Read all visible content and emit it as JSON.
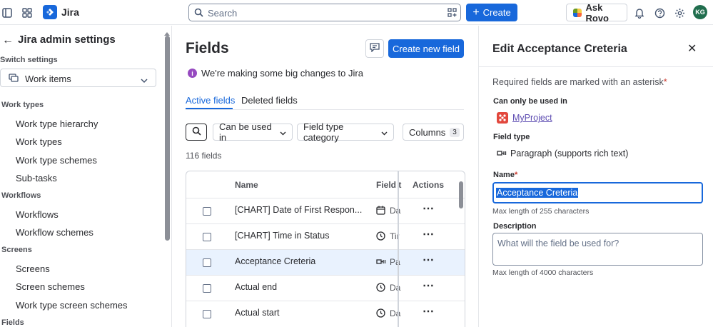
{
  "topbar": {
    "app_name": "Jira",
    "search_placeholder": "Search",
    "create_label": "Create",
    "rovo_label": "Ask Rovo",
    "avatar_initials": "KG",
    "accent_color": "#1868db"
  },
  "sidebar": {
    "title": "Jira admin settings",
    "switch_label": "Switch settings",
    "switch_value": "Work items",
    "sections": [
      {
        "label": "Work types",
        "items": [
          "Work type hierarchy",
          "Work types",
          "Work type schemes",
          "Sub-tasks"
        ]
      },
      {
        "label": "Workflows",
        "items": [
          "Workflows",
          "Workflow schemes"
        ]
      },
      {
        "label": "Screens",
        "items": [
          "Screens",
          "Screen schemes",
          "Work type screen schemes"
        ]
      },
      {
        "label": "Fields",
        "items": []
      }
    ]
  },
  "main": {
    "title": "Fields",
    "create_button": "Create new field",
    "notice": "We're making some big changes to Jira",
    "tabs": [
      {
        "label": "Active fields",
        "active": true
      },
      {
        "label": "Deleted fields",
        "active": false
      }
    ],
    "filters": {
      "can_be_used_in": "Can be used in",
      "field_type_category": "Field type category",
      "columns": "Columns",
      "columns_count": "3"
    },
    "fields_count": "116 fields",
    "table": {
      "headers": {
        "name": "Name",
        "field_type": "Field t",
        "actions": "Actions"
      },
      "rows": [
        {
          "name": "[CHART] Date of First Respon...",
          "type": "Da",
          "icon": "calendar-icon",
          "selected": false
        },
        {
          "name": "[CHART] Time in Status",
          "type": "Tir",
          "icon": "clock-icon",
          "selected": false
        },
        {
          "name": "Acceptance Creteria",
          "type": "Pa",
          "icon": "paragraph-icon",
          "selected": true
        },
        {
          "name": "Actual end",
          "type": "Da",
          "icon": "clock-icon",
          "selected": false
        },
        {
          "name": "Actual start",
          "type": "Da",
          "icon": "clock-icon",
          "selected": false
        }
      ],
      "actions_glyph": "⋯"
    }
  },
  "panel": {
    "title": "Edit Acceptance Creteria",
    "required_note": "Required fields are marked with an asterisk",
    "asterisk": "*",
    "can_only_label": "Can only be used in",
    "project_name": "MyProject",
    "field_type_label": "Field type",
    "field_type_value": "Paragraph (supports rich text)",
    "name_label": "Name",
    "name_value": "Acceptance Creteria",
    "name_hint": "Max length of 255 characters",
    "description_label": "Description",
    "description_placeholder": "What will the field be used for?",
    "description_hint": "Max length of 4000 characters"
  }
}
